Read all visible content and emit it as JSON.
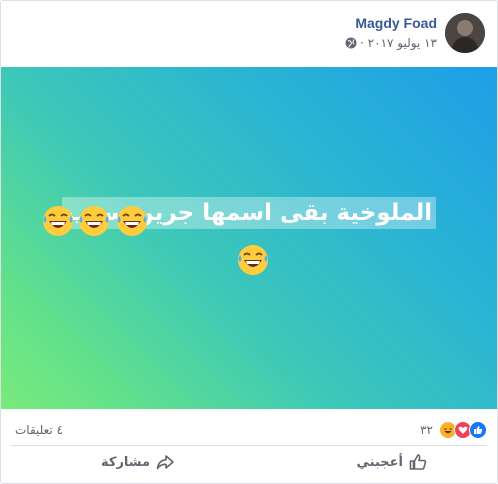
{
  "post": {
    "author": "Magdy Foad",
    "date": "١٣ يوليو ٢٠١٧ ·",
    "privacy_icon": "globe-icon",
    "text": "الملوخية بقى اسمها جرين سوب",
    "emoji": "laughing-tears-emoji",
    "background_gradient": [
      "#1e9ee8",
      "#79ea7a"
    ]
  },
  "reactions": {
    "count": "٣٢",
    "types": [
      "like",
      "love",
      "haha"
    ],
    "comments_label": "٤ تعليقات"
  },
  "actions": {
    "like_label": "أعجبني",
    "share_label": "مشاركة"
  },
  "colors": {
    "author": "#385898",
    "meta": "#616770",
    "like_blue": "#1877f2",
    "love_red": "#f33e58",
    "haha_yellow": "#f7b125"
  }
}
